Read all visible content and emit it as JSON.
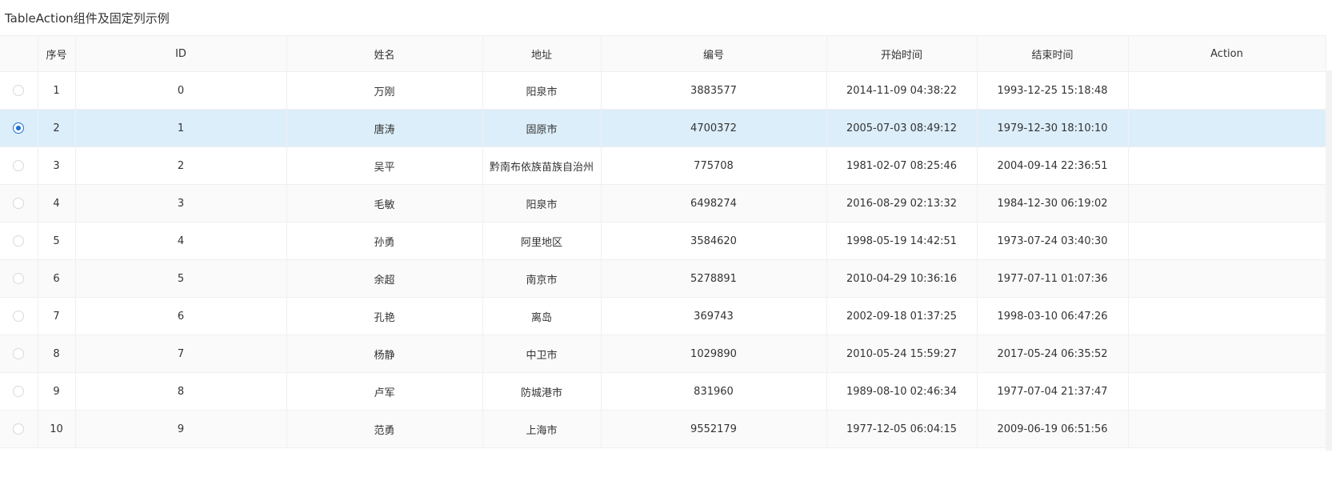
{
  "page": {
    "title": "TableAction组件及固定列示例"
  },
  "table": {
    "columns": [
      "",
      "序号",
      "ID",
      "姓名",
      "地址",
      "编号",
      "开始时间",
      "结束时间",
      "Action"
    ],
    "selected_index": 1,
    "rows": [
      {
        "index": "1",
        "id": "0",
        "name": "万刚",
        "address": "阳泉市",
        "no": "3883577",
        "start": "2014-11-09 04:38:22",
        "end": "1993-12-25 15:18:48"
      },
      {
        "index": "2",
        "id": "1",
        "name": "唐涛",
        "address": "固原市",
        "no": "4700372",
        "start": "2005-07-03 08:49:12",
        "end": "1979-12-30 18:10:10"
      },
      {
        "index": "3",
        "id": "2",
        "name": "吴平",
        "address": "黔南布依族苗族自治州",
        "no": "775708",
        "start": "1981-02-07 08:25:46",
        "end": "2004-09-14 22:36:51"
      },
      {
        "index": "4",
        "id": "3",
        "name": "毛敏",
        "address": "阳泉市",
        "no": "6498274",
        "start": "2016-08-29 02:13:32",
        "end": "1984-12-30 06:19:02"
      },
      {
        "index": "5",
        "id": "4",
        "name": "孙勇",
        "address": "阿里地区",
        "no": "3584620",
        "start": "1998-05-19 14:42:51",
        "end": "1973-07-24 03:40:30"
      },
      {
        "index": "6",
        "id": "5",
        "name": "余超",
        "address": "南京市",
        "no": "5278891",
        "start": "2010-04-29 10:36:16",
        "end": "1977-07-11 01:07:36"
      },
      {
        "index": "7",
        "id": "6",
        "name": "孔艳",
        "address": "离岛",
        "no": "369743",
        "start": "2002-09-18 01:37:25",
        "end": "1998-03-10 06:47:26"
      },
      {
        "index": "8",
        "id": "7",
        "name": "杨静",
        "address": "中卫市",
        "no": "1029890",
        "start": "2010-05-24 15:59:27",
        "end": "2017-05-24 06:35:52"
      },
      {
        "index": "9",
        "id": "8",
        "name": "卢军",
        "address": "防城港市",
        "no": "831960",
        "start": "1989-08-10 02:46:34",
        "end": "1977-07-04 21:37:47"
      },
      {
        "index": "10",
        "id": "9",
        "name": "范勇",
        "address": "上海市",
        "no": "9552179",
        "start": "1977-12-05 06:04:15",
        "end": "2009-06-19 06:51:56"
      }
    ]
  },
  "colors": {
    "selected_row": "#dceef9",
    "striped_row": "#fafafa",
    "header_bg": "#fafafa",
    "radio_checked": "#1a6fd6"
  }
}
